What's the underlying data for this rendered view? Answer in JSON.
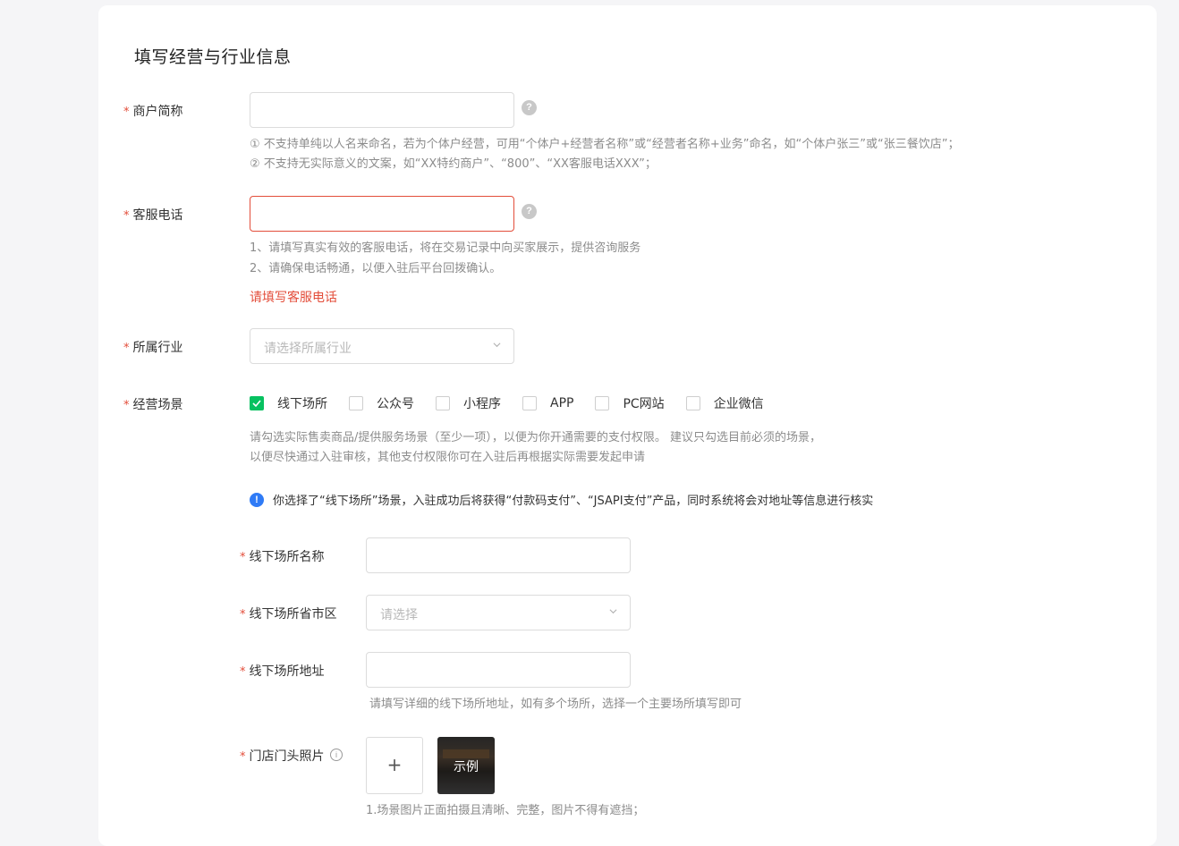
{
  "section": {
    "title": "填写经营与行业信息"
  },
  "merchant_name": {
    "required_mark": "*",
    "label": "商户简称",
    "value": "",
    "placeholder": "",
    "help_icon": "question-circle-icon",
    "hints": [
      "① 不支持单纯以人名来命名，若为个体户经营，可用“个体户+经营者名称”或“经营者名称+业务”命名，如“个体户张三”或“张三餐饮店”；",
      "② 不支持无实际意义的文案，如“XX特约商户”、“800”、“XX客服电话XXX”；"
    ]
  },
  "service_phone": {
    "required_mark": "*",
    "label": "客服电话",
    "value": "",
    "placeholder": "",
    "help_icon": "question-circle-icon",
    "hints": [
      "1、请填写真实有效的客服电话，将在交易记录中向买家展示，提供咨询服务",
      "2、请确保电话畅通，以便入驻后平台回拨确认。"
    ],
    "error": "请填写客服电话"
  },
  "industry": {
    "required_mark": "*",
    "label": "所属行业",
    "placeholder": "请选择所属行业",
    "icon": "chevron-down-icon"
  },
  "scenes": {
    "required_mark": "*",
    "label": "经营场景",
    "options": [
      {
        "label": "线下场所",
        "checked": true
      },
      {
        "label": "公众号",
        "checked": false
      },
      {
        "label": "小程序",
        "checked": false
      },
      {
        "label": "APP",
        "checked": false
      },
      {
        "label": "PC网站",
        "checked": false
      },
      {
        "label": "企业微信",
        "checked": false
      }
    ],
    "hints": [
      "请勾选实际售卖商品/提供服务场景（至少一项），以便为你开通需要的支付权限。 建议只勾选目前必须的场景，",
      "以便尽快通过入驻审核，其他支付权限你可在入驻后再根据实际需要发起申请"
    ],
    "notice": "你选择了“线下场所”场景，入驻成功后将获得“付款码支付”、“JSAPI支付”产品，同时系统将会对地址等信息进行核实",
    "notice_icon": "info-circle-icon",
    "accent_color": "#07c160"
  },
  "offline": {
    "name": {
      "required_mark": "*",
      "label": "线下场所名称",
      "value": ""
    },
    "region": {
      "required_mark": "*",
      "label": "线下场所省市区",
      "placeholder": "请选择",
      "icon": "chevron-down-icon"
    },
    "address": {
      "required_mark": "*",
      "label": "线下场所地址",
      "value": "",
      "hint": "请填写详细的线下场所地址，如有多个场所，选择一个主要场所填写即可"
    },
    "storefront_photo": {
      "required_mark": "*",
      "label": "门店门头照片",
      "info_icon": "info-circle-outline-icon",
      "upload_symbol": "+",
      "example_label": "示例",
      "hint": "1.场景图片正面拍摄且清晰、完整，图片不得有遮挡；"
    }
  },
  "colors": {
    "error": "#e34d3a",
    "checkbox_checked": "#07c160",
    "info": "#2f7bf6"
  }
}
